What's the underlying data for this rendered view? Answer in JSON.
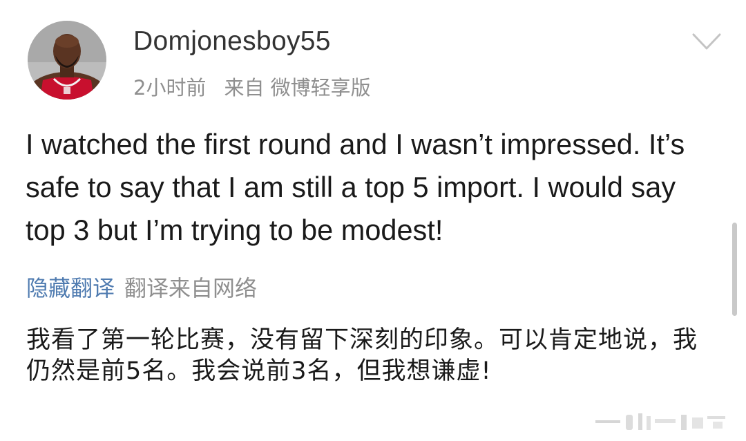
{
  "post": {
    "username": "Domjonesboy55",
    "time": "2小时前",
    "source": "来自 微博轻享版",
    "body": "I watched the first round and I wasn’t impressed. It’s safe to say that I am still a top 5 import. I would say top 3 but I’m trying to be modest!"
  },
  "translation": {
    "hide_label": "隐藏翻译",
    "source_label": "翻译来自网络",
    "text": "我看了第一轮比赛，没有留下深刻的印象。可以肯定地说，我仍然是前5名。我会说前3名，但我想谦虚!"
  },
  "icons": {
    "menu": "chevron-down-icon",
    "avatar": "avatar-photo"
  },
  "colors": {
    "link": "#4f7bb0",
    "meta": "#8f8f8f",
    "text": "#1a1a1a",
    "jersey": "#c8102e"
  }
}
